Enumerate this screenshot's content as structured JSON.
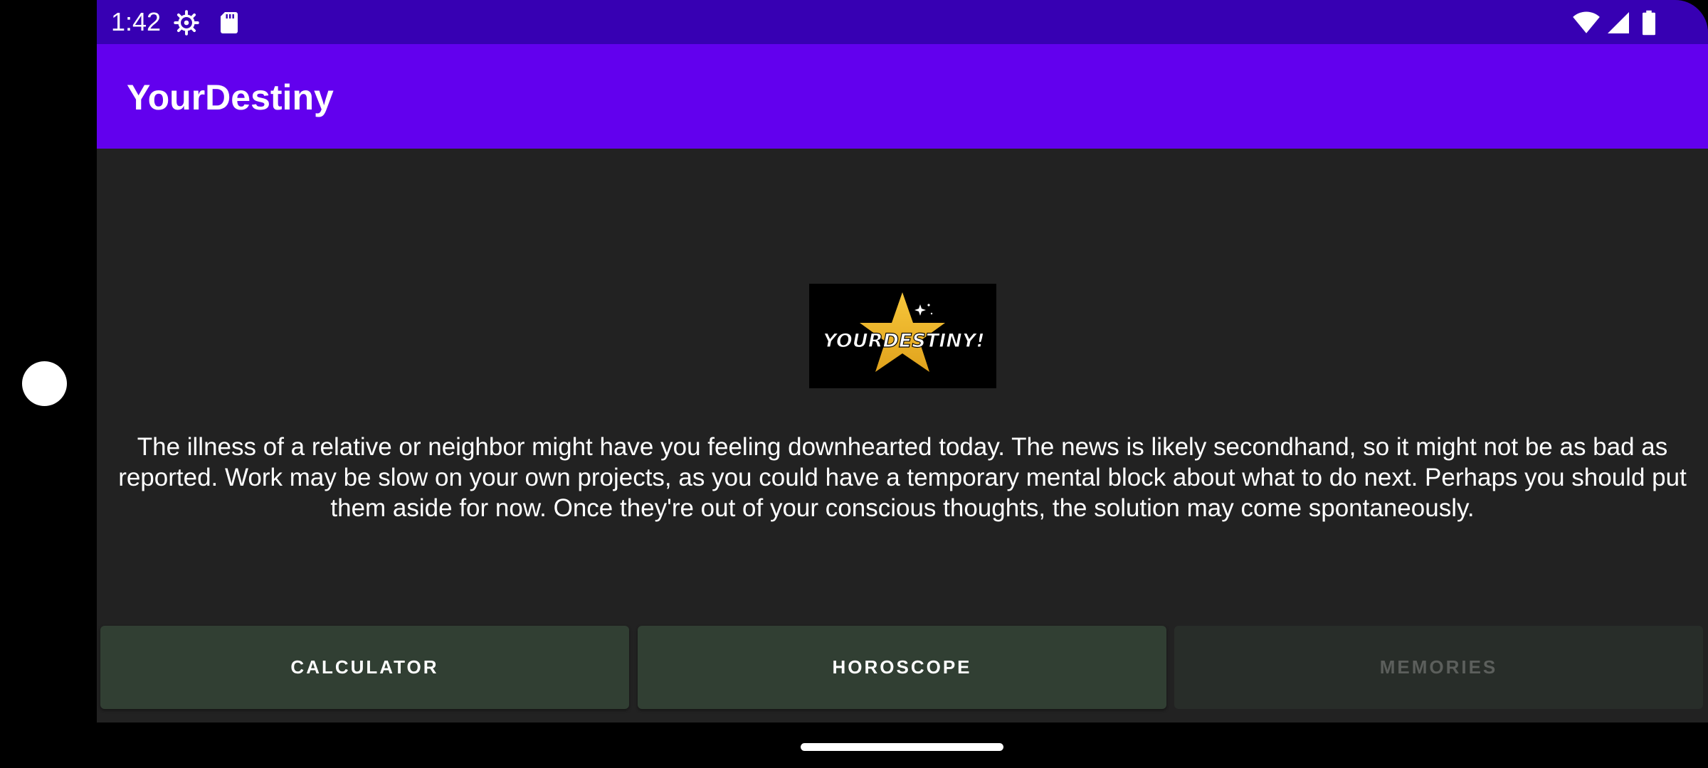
{
  "status_bar": {
    "time": "1:42",
    "left_icons": [
      "settings-icon",
      "sd-card-icon"
    ],
    "right_icons": [
      "wifi-icon",
      "cellular-signal-icon",
      "battery-icon"
    ]
  },
  "app_bar": {
    "title": "YourDestiny"
  },
  "logo": {
    "text": "YOURDESTINY!"
  },
  "horoscope": {
    "text": "The illness of a relative or neighbor might have you feeling downhearted today. The news is likely secondhand, so it might not be as bad as reported. Work may be slow on your own projects, as you could have a temporary mental block about what to do next. Perhaps you should put them aside for now. Once they're out of your conscious thoughts, the solution may come spontaneously."
  },
  "buttons": {
    "calculator": "CALCULATOR",
    "horoscope": "HOROSCOPE",
    "memories": "MEMORIES"
  },
  "colors": {
    "status_bar": "#3700b3",
    "app_bar": "#6200ee",
    "background": "#222222",
    "button": "#313f33",
    "button_disabled": "#282d29"
  }
}
